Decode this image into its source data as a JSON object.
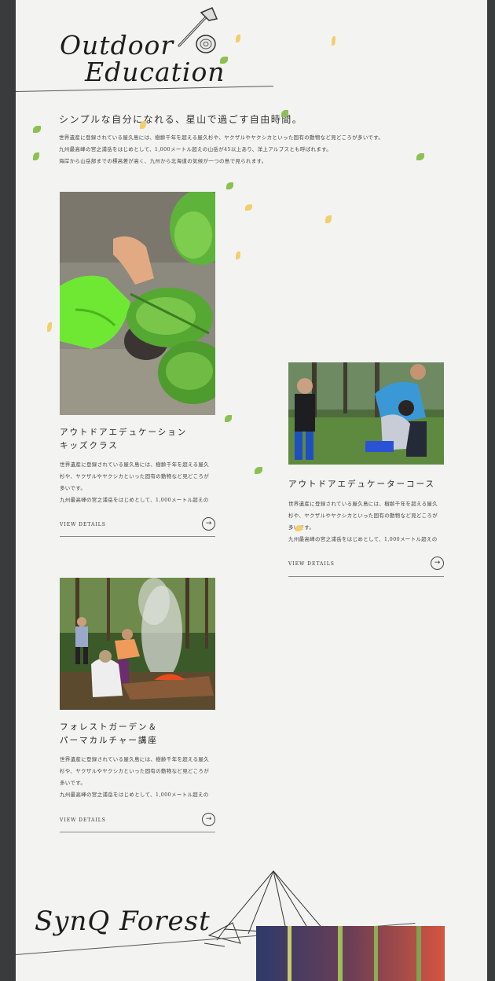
{
  "header": {
    "title_line1": "Outdoor",
    "title_line2": "Education",
    "axe_icon": "axe-icon"
  },
  "lead": "シンプルな自分になれる、星山で過ごす自由時間。",
  "intro_lines": [
    "世界遺産に登録されている屋久島には、樹齢千年を超える屋久杉や、ヤクザルやヤクシカといった固有の動物など見どころが多いです。",
    "九州最高峰の宮之浦岳をはじめとして、1,000メートル超えの山岳が45以上あり、洋上アルプスとも呼ばれます。",
    "海岸から山岳部までの標高差が高く、九州から北海道の気候が一つの島で見られます。"
  ],
  "cards": [
    {
      "title_lines": [
        "アウトドアエデュケーション",
        "キッズクラス"
      ],
      "text_lines": [
        "世界遺産に登録されている屋久島には、樹齢千年を超える屋久",
        "杉や、ヤクザルやヤクシカといった固有の動物など見どころが",
        "多いです。",
        "九州最高峰の宮之浦岳をはじめとして、1,000メートル超えの"
      ],
      "details_label": "VIEW DETAILS",
      "arrow": "→"
    },
    {
      "title_lines": [
        "アウトドアエデュケーターコース"
      ],
      "text_lines": [
        "世界遺産に登録されている屋久島には、樹齢千年を超える屋久",
        "杉や、ヤクザルやヤクシカといった固有の動物など見どころが",
        "多いです。",
        "九州最高峰の宮之浦岳をはじめとして、1,000メートル超えの"
      ],
      "details_label": "VIEW DETAILS",
      "arrow": "→"
    },
    {
      "title_lines": [
        "フォレストガーデン＆",
        "パーマカルチャー講座"
      ],
      "text_lines": [
        "世界遺産に登録されている屋久島には、樹齢千年を超える屋久",
        "杉や、ヤクザルやヤクシカといった固有の動物など見どころが",
        "多いです。",
        "九州最高峰の宮之浦岳をはじめとして、1,000メートル超えの"
      ],
      "details_label": "VIEW DETAILS",
      "arrow": "→"
    }
  ],
  "forest": {
    "title": "SynQ Forest",
    "tent_icon": "tent-icon"
  },
  "colors": {
    "background": "#f3f3f1",
    "frame": "#3a3b3d",
    "leaf_green": "#8cc152",
    "leaf_yellow": "#f2cf6b"
  }
}
